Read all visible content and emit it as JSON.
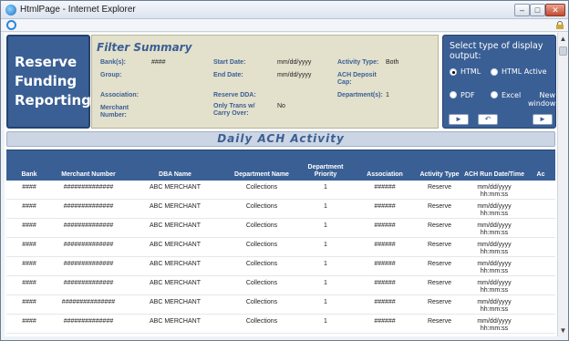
{
  "window": {
    "title": "HtmlPage - Internet Explorer",
    "min": "–",
    "max": "□",
    "close": "✕"
  },
  "brand": {
    "line1": "Reserve",
    "line2": "Funding",
    "line3": "Reporting"
  },
  "filter": {
    "title": "Filter Summary",
    "banks_label": "Bank(s):",
    "banks_value": "####",
    "group_label": "Group:",
    "association_label": "Association:",
    "merchant_label": "Merchant Number:",
    "start_label": "Start Date:",
    "start_value": "mm/dd/yyyy",
    "end_label": "End Date:",
    "end_value": "mm/dd/yyyy",
    "reserve_dda_label": "Reserve DDA:",
    "only_trans_label": "Only Trans w/ Carry Over:",
    "only_trans_value": "No",
    "activity_label": "Activity Type:",
    "activity_value": "Both",
    "ach_cap_label": "ACH Deposit Cap:",
    "dept_label": "Department(s):",
    "dept_value": "1"
  },
  "display": {
    "title": "Select type of display output:",
    "html": "HTML",
    "html_active": "HTML Active",
    "pdf": "PDF",
    "excel": "Excel",
    "new_window": "New window:",
    "selected": "HTML",
    "btn_go": "►",
    "btn_back": "↶",
    "btn_new": "►"
  },
  "section_title": "Daily ACH Activity",
  "columns": [
    "Bank",
    "Merchant Number",
    "DBA Name",
    "Department Name",
    "Department Priority",
    "Association",
    "Activity Type",
    "ACH Run Date/Time",
    "Ac"
  ],
  "rows": [
    {
      "bank": "####",
      "merchant": "##############",
      "dba": "ABC MERCHANT",
      "dept": "Collections",
      "priority": "1",
      "assoc": "######",
      "type": "Reserve",
      "date": "mm/dd/yyyy",
      "time": "hh:mm:ss"
    },
    {
      "bank": "####",
      "merchant": "##############",
      "dba": "ABC MERCHANT",
      "dept": "Collections",
      "priority": "1",
      "assoc": "######",
      "type": "Reserve",
      "date": "mm/dd/yyyy",
      "time": "hh:mm:ss"
    },
    {
      "bank": "####",
      "merchant": "##############",
      "dba": "ABC MERCHANT",
      "dept": "Collections",
      "priority": "1",
      "assoc": "######",
      "type": "Reserve",
      "date": "mm/dd/yyyy",
      "time": "hh:mm:ss"
    },
    {
      "bank": "####",
      "merchant": "##############",
      "dba": "ABC MERCHANT",
      "dept": "Collections",
      "priority": "1",
      "assoc": "######",
      "type": "Reserve",
      "date": "mm/dd/yyyy",
      "time": "hh:mm:ss"
    },
    {
      "bank": "####",
      "merchant": "##############",
      "dba": "ABC MERCHANT",
      "dept": "Collections",
      "priority": "1",
      "assoc": "######",
      "type": "Reserve",
      "date": "mm/dd/yyyy",
      "time": "hh:mm:ss"
    },
    {
      "bank": "####",
      "merchant": "##############",
      "dba": "ABC MERCHANT",
      "dept": "Collections",
      "priority": "1",
      "assoc": "######",
      "type": "Reserve",
      "date": "mm/dd/yyyy",
      "time": "hh:mm:ss"
    },
    {
      "bank": "####",
      "merchant": "###############",
      "dba": "ABC MERCHANT",
      "dept": "Collections",
      "priority": "1",
      "assoc": "######",
      "type": "Reserve",
      "date": "mm/dd/yyyy",
      "time": "hh:mm:ss"
    },
    {
      "bank": "####",
      "merchant": "##############",
      "dba": "ABC MERCHANT",
      "dept": "Collections",
      "priority": "1",
      "assoc": "######",
      "type": "Reserve",
      "date": "mm/dd/yyyy",
      "time": "hh:mm:ss"
    }
  ],
  "colors": {
    "brand": "#3a5f95",
    "filter_bg": "#e3e0cb",
    "section_bg": "#ccd5e3"
  },
  "icons": [
    "ie-icon",
    "lock-icon",
    "scroll-up-icon",
    "scroll-down-icon"
  ]
}
